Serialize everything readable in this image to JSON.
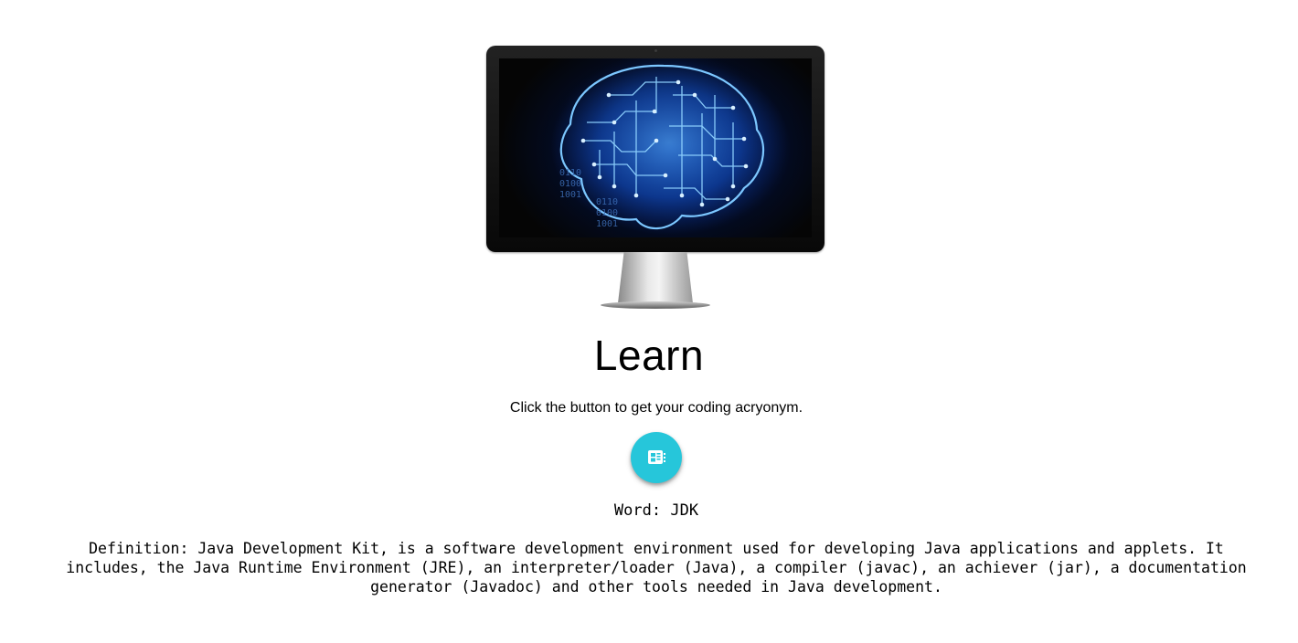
{
  "hero": {
    "image_icon": "monitor-brain-circuit-image",
    "screen_binary": [
      "0110",
      "0100",
      "1001"
    ]
  },
  "page": {
    "title": "Learn",
    "subtitle": "Click the button to get your coding acryonym."
  },
  "action_button": {
    "icon": "generate-icon",
    "color": "#26c6da"
  },
  "result": {
    "word_label": "Word: ",
    "word": "JDK",
    "definition_label": "Definition: ",
    "definition": "Java Development Kit, is a software development environment used for developing Java applications and applets. It includes, the Java Runtime Environment (JRE), an interpreter/loader (Java), a compiler (javac), an achiever (jar), a documentation generator (Javadoc) and other tools needed in Java development."
  }
}
